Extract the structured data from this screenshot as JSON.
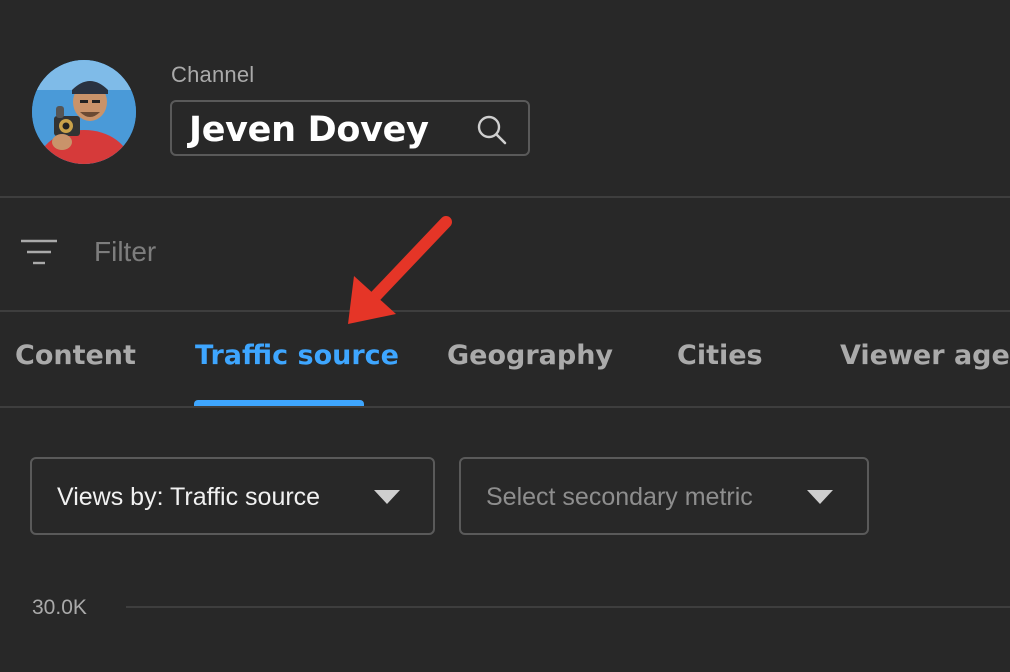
{
  "header": {
    "channel_label": "Channel",
    "channel_name": "Jeven Dovey"
  },
  "filter": {
    "placeholder": "Filter"
  },
  "tabs": [
    {
      "label": "Content",
      "active": false
    },
    {
      "label": "Traffic source",
      "active": true
    },
    {
      "label": "Geography",
      "active": false
    },
    {
      "label": "Cities",
      "active": false
    },
    {
      "label": "Viewer age",
      "active": false
    }
  ],
  "dropdowns": {
    "primary_metric": "Views by: Traffic source",
    "secondary_metric_placeholder": "Select secondary metric"
  },
  "chart": {
    "y_tick_top": "30.0K"
  },
  "icons": {
    "search": "search-icon",
    "filter": "filter-icon",
    "dropdown": "caret-down-icon"
  },
  "colors": {
    "accent": "#3ea6ff",
    "background": "#282828",
    "annotation_arrow": "#e53527"
  }
}
